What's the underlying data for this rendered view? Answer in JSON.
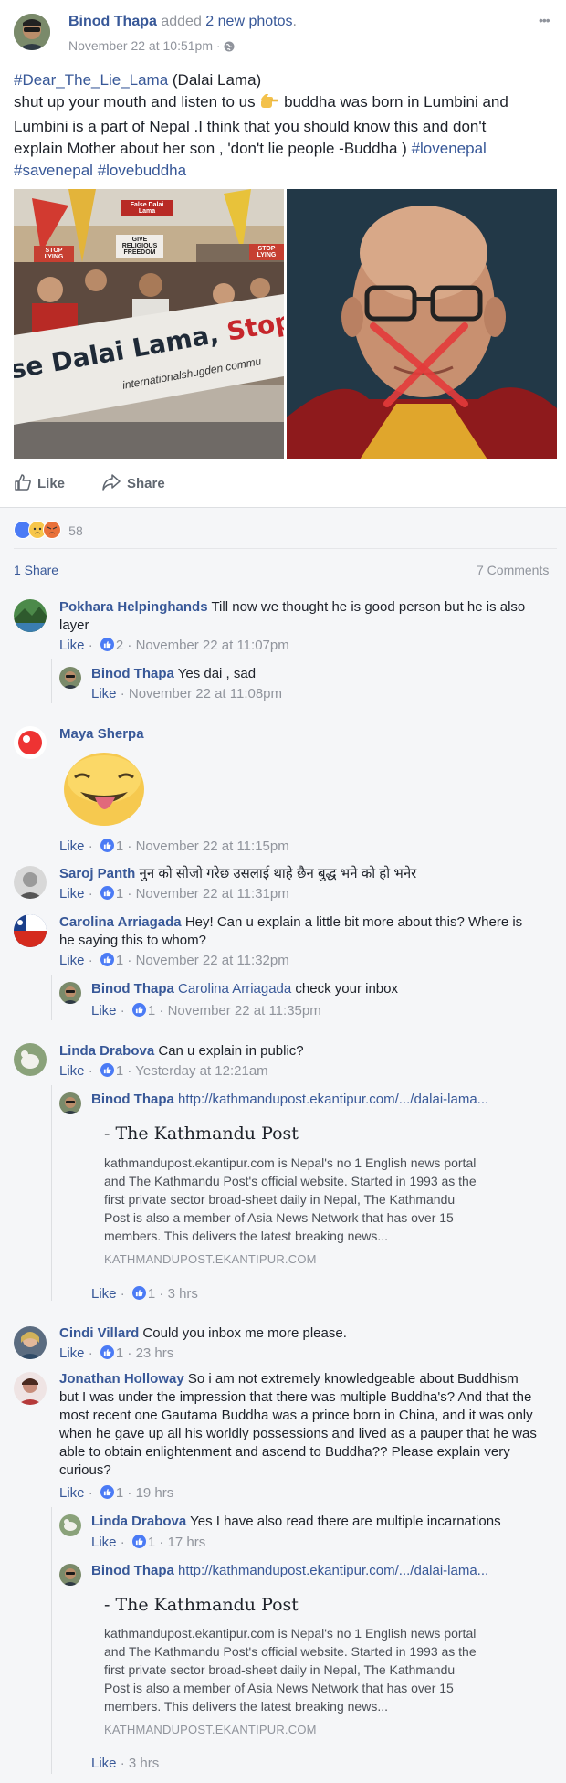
{
  "post": {
    "author": "Binod Thapa",
    "action": "added",
    "action_link": "2 new photos",
    "action_tail": ".",
    "timestamp": "November 22 at 10:51pm",
    "timestamp_sep": "·",
    "menu": "•••",
    "body": {
      "hashtag1": "#Dear_The_Lie_Lama",
      "line1_tail": " (Dalai Lama)",
      "line2": "shut up your mouth and listen to us",
      "line2_tail": "buddha was born in Lumbini and",
      "line3": "Lumbini is a part of Nepal .I think that you should know this and don't",
      "line4_a": "explain Mother about her son , 'don't lie people -Buddha ) ",
      "hashtag2": "#lovenepal",
      "hashtag3": "#savenepal",
      "hashtag4": "#lovebuddha"
    },
    "photo1_text": {
      "banner_main": "se Dalai Lama, ",
      "banner_accent": "Stop Ly",
      "banner_sub": "internationalshugden commu",
      "sign1": "False Dalai Lama",
      "sign2": "STOP LYING",
      "sign3": "GIVE RELIGIOUS FREEDOM",
      "sign4": "STOP LYING"
    },
    "actions": {
      "like": "Like",
      "share": "Share"
    },
    "reactions_count": "58",
    "shares": "1 Share",
    "comments_count": "7 Comments"
  },
  "comments": [
    {
      "name": "Pokhara Helpinghands",
      "text": "Till now we thought he is good person but he is also",
      "text2": "layer",
      "like": "Like",
      "likes": "2",
      "time": "November 22 at 11:07pm"
    },
    {
      "name": "Binod Thapa",
      "text": "Yes dai , sad",
      "like": "Like",
      "time": "November 22 at 11:08pm"
    },
    {
      "name": "Maya Sherpa",
      "like": "Like",
      "likes": "1",
      "time": "November 22 at 11:15pm"
    },
    {
      "name": "Saroj Panth",
      "text": "नुन को सोजो गरेछ उसलाई थाहे छैन बुद्ध भने को हो भनेर",
      "like": "Like",
      "likes": "1",
      "time": "November 22 at 11:31pm"
    },
    {
      "name": "Carolina Arriagada",
      "text": "Hey! Can u explain a little bit more about this? Where is",
      "text2": "he saying this to whom?",
      "like": "Like",
      "likes": "1",
      "time": "November 22 at 11:32pm"
    },
    {
      "name": "Binod Thapa",
      "mention": "Carolina Arriagada",
      "text": "check your inbox",
      "like": "Like",
      "likes": "1",
      "time": "November 22 at 11:35pm"
    },
    {
      "name": "Linda Drabova",
      "text": "Can u explain in public?",
      "like": "Like",
      "likes": "1",
      "time": "Yesterday at 12:21am"
    },
    {
      "name": "Binod Thapa",
      "url": "http://kathmandupost.ekantipur.com/.../dalai-lama...",
      "like": "Like",
      "likes": "1",
      "time": "3 hrs"
    },
    {
      "name": "Cindi Villard",
      "text": "Could you inbox me more please.",
      "like": "Like",
      "likes": "1",
      "time": "23 hrs"
    },
    {
      "name": "Jonathan Holloway",
      "lines": [
        "So i am not extremely knowledgeable about Buddhism",
        "but I was under the impression that there was multiple Buddha's? And that the",
        "most recent one Gautama Buddha was a prince born in China, and it was only",
        "when he gave up all his worldly possessions and lived as a pauper that he was",
        "able to obtain enlightenment and ascend to Buddha?? Please explain very",
        "curious?"
      ],
      "like": "Like",
      "likes": "1",
      "time": "19 hrs"
    },
    {
      "name": "Linda Drabova",
      "text": "Yes I have also read there are multiple incarnations",
      "like": "Like",
      "likes": "1",
      "time": "17 hrs"
    },
    {
      "name": "Binod Thapa",
      "url": "http://kathmandupost.ekantipur.com/.../dalai-lama...",
      "like": "Like",
      "time": "3 hrs"
    }
  ],
  "preview": {
    "title": "- The Kathmandu Post",
    "desc": [
      "kathmandupost.ekantipur.com is Nepal's no 1 English news portal",
      "and The Kathmandu Post's official website. Started in 1993 as the",
      "first private sector broad-sheet daily in Nepal, The Kathmandu",
      "Post is also a member of Asia News Network that has over 15",
      "members. This delivers the latest breaking news..."
    ],
    "domain": "KATHMANDUPOST.EKANTIPUR.COM"
  },
  "colors": {
    "link": "#385898",
    "muted": "#90949c",
    "like_blue": "#4b7bf5",
    "bg": "#f5f6f8"
  }
}
